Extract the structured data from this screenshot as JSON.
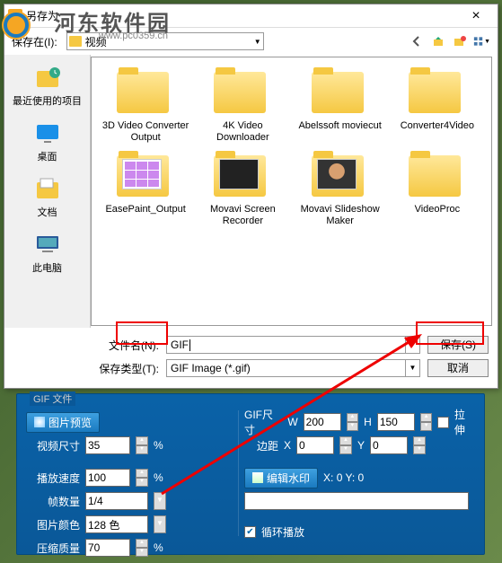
{
  "dialog": {
    "title": "另存为",
    "close": "×",
    "savein_label": "保存在(I):",
    "folder_value": "视频"
  },
  "watermark": {
    "text": "河东软件园",
    "sub": "www.pc0359.cn"
  },
  "sidebar": [
    {
      "label": "最近使用的项目"
    },
    {
      "label": "桌面"
    },
    {
      "label": "文档"
    },
    {
      "label": "此电脑"
    }
  ],
  "files": [
    {
      "label": "3D Video Converter Output",
      "thumb": ""
    },
    {
      "label": "4K Video Downloader",
      "thumb": ""
    },
    {
      "label": "Abelssoft moviecut",
      "thumb": ""
    },
    {
      "label": "Converter4Video",
      "thumb": ""
    },
    {
      "label": "EasePaint_Output",
      "thumb": "grid"
    },
    {
      "label": "Movavi Screen Recorder",
      "thumb": "dark"
    },
    {
      "label": "Movavi Slideshow Maker",
      "thumb": "face"
    },
    {
      "label": "VideoProc",
      "thumb": ""
    }
  ],
  "fields": {
    "filename_label": "文件名(N):",
    "filename_value": "GIF",
    "filetype_label": "保存类型(T):",
    "filetype_value": "GIF Image (*.gif)",
    "save_btn": "保存(S)",
    "cancel_btn": "取消"
  },
  "settings": {
    "group_title": "GIF 文件",
    "preview_btn": "图片预览",
    "gif_size_label": "GIF尺寸",
    "w_label": "W",
    "w_value": "200",
    "h_label": "H",
    "h_value": "150",
    "stretch_label": "拉伸",
    "video_size_label": "视频尺寸",
    "video_size_value": "35",
    "pct": "%",
    "margin_label": "边距",
    "mx_label": "X",
    "mx_value": "0",
    "my_label": "Y",
    "my_value": "0",
    "playspeed_label": "播放速度",
    "playspeed_value": "100",
    "watermark_btn": "编辑水印",
    "wm_coord": "X: 0  Y: 0",
    "frames_label": "帧数量",
    "frames_value": "1/4",
    "color_label": "图片颜色",
    "color_value": "128 色",
    "quality_label": "压缩质量",
    "quality_value": "70",
    "loop_label": "循环播放"
  }
}
